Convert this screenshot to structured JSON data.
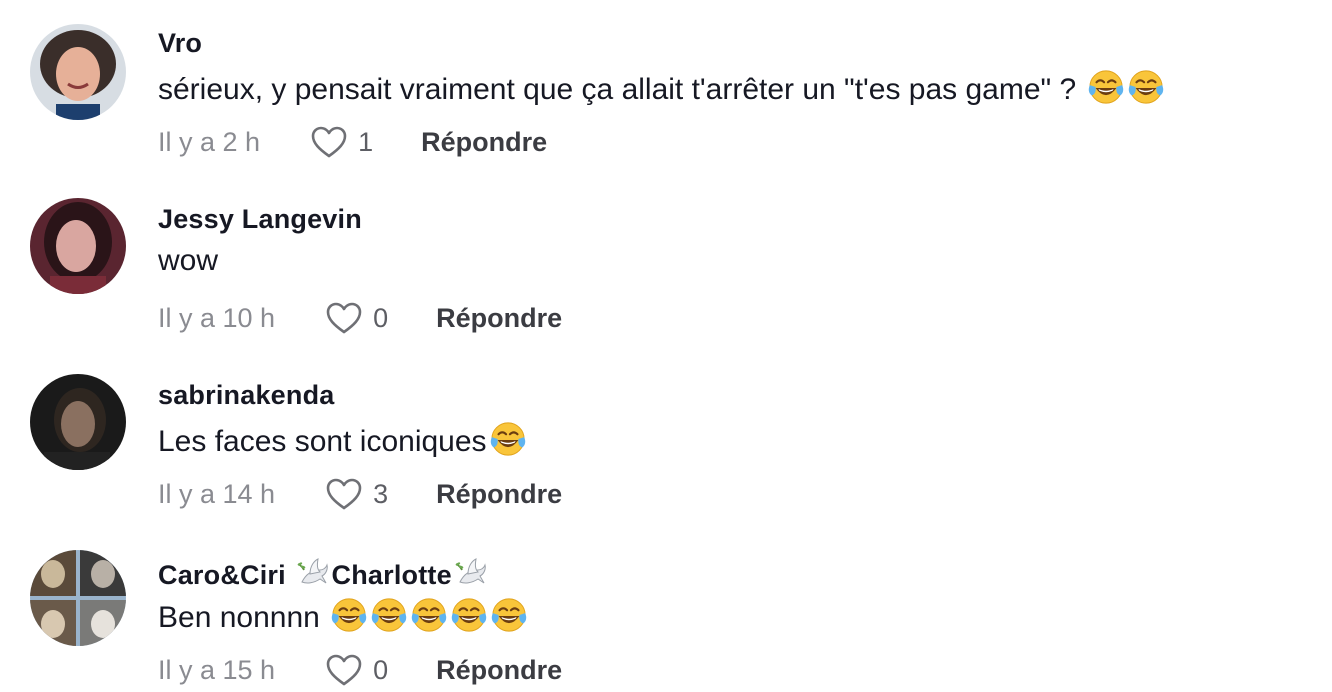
{
  "comments": [
    {
      "username": "Vro",
      "text": "sérieux, y pensait vraiment que ça allait t'arrêter un \"t'es pas game\" ? ",
      "emoji": [
        "face-with-tears-of-joy-icon",
        "face-with-tears-of-joy-icon"
      ],
      "time": "Il y a 2 h",
      "likes": "1",
      "reply_label": "Répondre"
    },
    {
      "username": "Jessy Langevin",
      "text": "wow",
      "time": "Il y a 10 h",
      "likes": "0",
      "reply_label": "Répondre"
    },
    {
      "username": "sabrinakenda",
      "text": "Les faces sont iconiques",
      "emoji": [
        "face-with-tears-of-joy-icon"
      ],
      "time": "Il y a 14 h",
      "likes": "3",
      "reply_label": "Répondre"
    },
    {
      "username_part1": "Caro&Ciri ",
      "username_part2": "Charlotte",
      "username_icons": [
        "dove-of-peace-icon",
        "dove-of-peace-icon"
      ],
      "text": "Ben nonnnn ",
      "emoji": [
        "face-with-tears-of-joy-icon",
        "face-with-tears-of-joy-icon",
        "face-with-tears-of-joy-icon",
        "face-with-tears-of-joy-icon",
        "face-with-tears-of-joy-icon"
      ],
      "time": "Il y a 15 h",
      "likes": "0",
      "reply_label": "Répondre"
    }
  ],
  "colors": {
    "text": "#161823",
    "muted": "#8a8b91",
    "reply": "#3b3c42",
    "emoji_face": "#f9c53a"
  }
}
